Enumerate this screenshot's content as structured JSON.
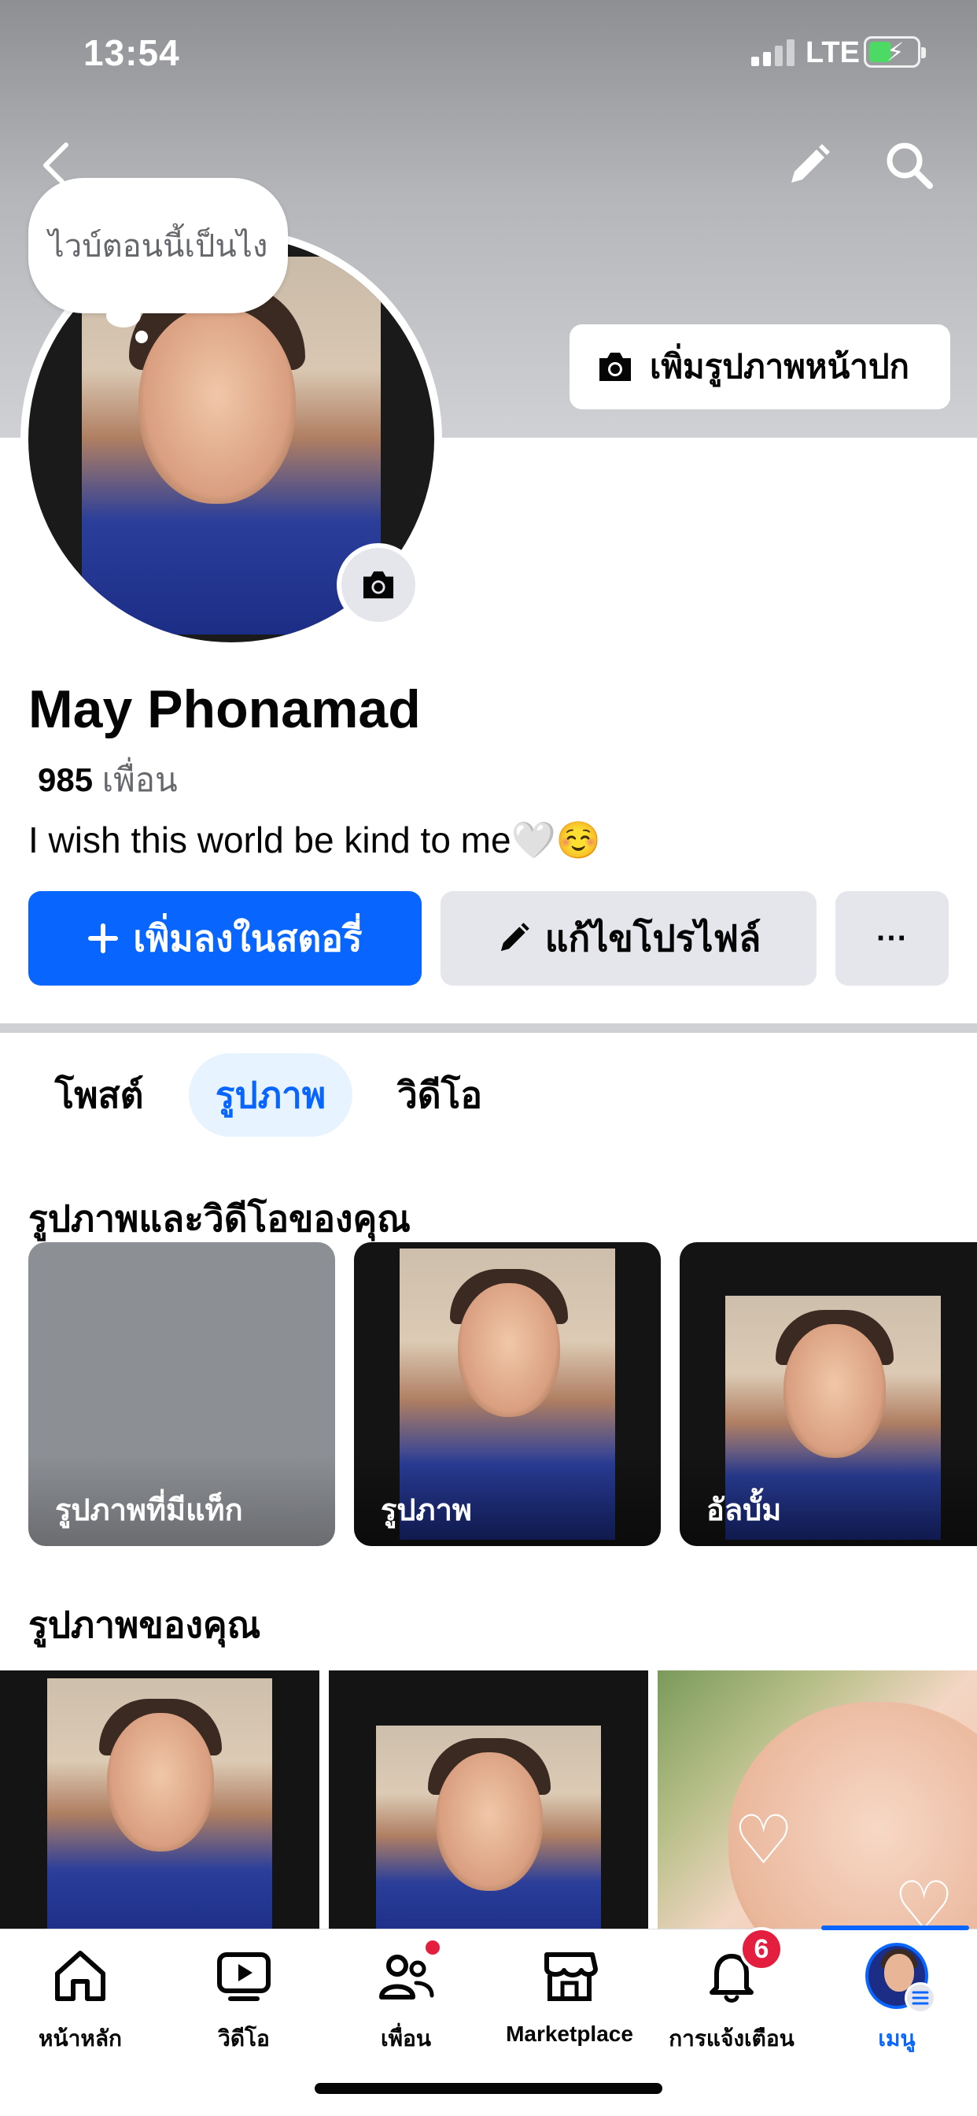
{
  "status_bar": {
    "time": "13:54",
    "network": "LTE"
  },
  "header": {
    "back_icon": "chevron-left-icon",
    "edit_icon": "pencil-icon",
    "search_icon": "search-icon",
    "add_cover_label": "เพิ่มรูปภาพหน้าปก"
  },
  "profile": {
    "thought_bubble": "ไวบ์ตอนนี้เป็นไง",
    "name": "May Phonamad",
    "friends_count": "985",
    "friends_label": "เพื่อน",
    "bio": "I wish this world be kind to me🤍☺️"
  },
  "actions": {
    "add_story_label": "เพิ่มลงในสตอรี่",
    "edit_profile_label": "แก้ไขโปรไฟล์",
    "more_label": "···"
  },
  "tabs": [
    {
      "label": "โพสต์",
      "selected": false
    },
    {
      "label": "รูปภาพ",
      "selected": true
    },
    {
      "label": "วิดีโอ",
      "selected": false
    }
  ],
  "sections": {
    "photos_and_videos_title": "รูปภาพและวิดีโอของคุณ",
    "albums": [
      {
        "label": "รูปภาพที่มีแท็ก"
      },
      {
        "label": "รูปภาพ"
      },
      {
        "label": "อัลบั้ม"
      }
    ],
    "your_photos_title": "รูปภาพของคุณ"
  },
  "bottom_nav": [
    {
      "label": "หน้าหลัก",
      "icon": "home-icon"
    },
    {
      "label": "วิดีโอ",
      "icon": "video-icon"
    },
    {
      "label": "เพื่อน",
      "icon": "friends-icon",
      "dot": true
    },
    {
      "label": "Marketplace",
      "icon": "marketplace-icon"
    },
    {
      "label": "การแจ้งเตือน",
      "icon": "bell-icon",
      "badge": "6"
    },
    {
      "label": "เมนู",
      "icon": "menu-avatar-icon",
      "selected": true
    }
  ],
  "colors": {
    "accent": "#0866ff",
    "badge": "#e41e3f",
    "secondary_text": "#65676b"
  }
}
